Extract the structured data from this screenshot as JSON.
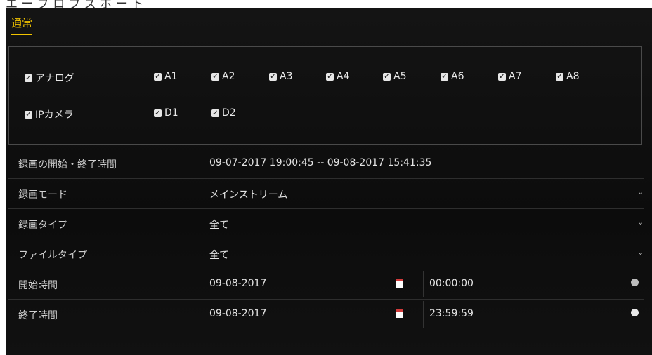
{
  "window": {
    "title": "エ ー ブ ロ ブ ズ ボ ー ト"
  },
  "tabs": [
    {
      "label": "通常",
      "active": true
    }
  ],
  "channels": {
    "analog": {
      "label": "アナログ",
      "checked": true,
      "items": [
        {
          "label": "A1",
          "checked": true
        },
        {
          "label": "A2",
          "checked": true
        },
        {
          "label": "A3",
          "checked": true
        },
        {
          "label": "A4",
          "checked": true
        },
        {
          "label": "A5",
          "checked": true
        },
        {
          "label": "A6",
          "checked": true
        },
        {
          "label": "A7",
          "checked": true
        },
        {
          "label": "A8",
          "checked": true
        }
      ]
    },
    "ip_camera": {
      "label": "IPカメラ",
      "checked": true,
      "items": [
        {
          "label": "D1",
          "checked": true
        },
        {
          "label": "D2",
          "checked": true
        }
      ]
    }
  },
  "form": {
    "rec_period": {
      "label": "録画の開始・終了時間",
      "value": "09-07-2017 19:00:45 -- 09-08-2017 15:41:35"
    },
    "rec_mode": {
      "label": "録画モード",
      "value": "メインストリーム"
    },
    "rec_type": {
      "label": "録画タイプ",
      "value": "全て"
    },
    "file_type": {
      "label": "ファイルタイプ",
      "value": "全て"
    },
    "start_time": {
      "label": "開始時間",
      "date": "09-08-2017",
      "time": "00:00:00"
    },
    "end_time": {
      "label": "終了時間",
      "date": "09-08-2017",
      "time": "23:59:59"
    }
  },
  "icons": {
    "checkbox": "checkmark",
    "dropdown": "chevron-down-icon",
    "calendar": "calendar-icon",
    "clock": "clock-icon"
  },
  "colors": {
    "accent": "#f2c400",
    "background": "#101010",
    "checkbox": "#e6e6e6",
    "calendar_header": "#d23b3b"
  }
}
